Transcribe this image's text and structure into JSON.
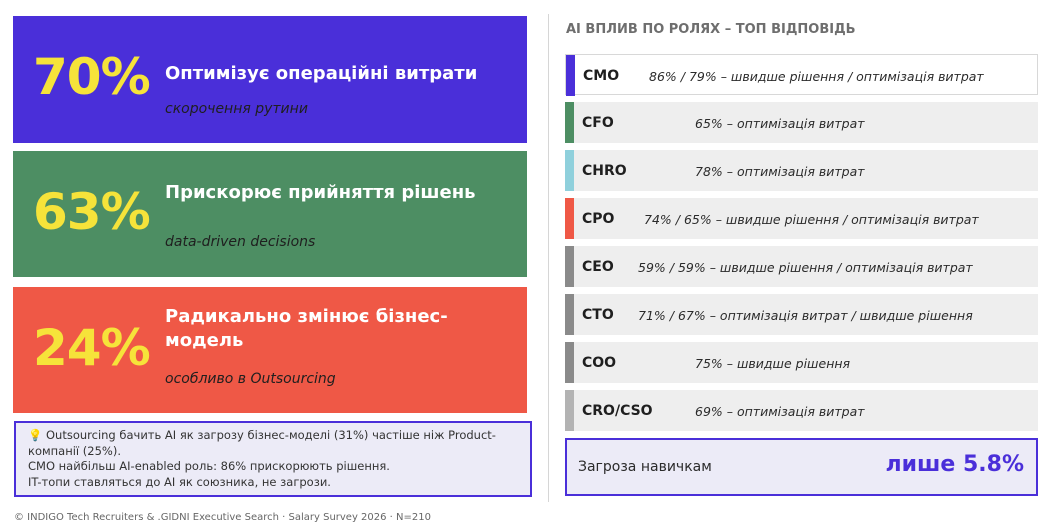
{
  "cards": [
    {
      "pct": "70%",
      "title": "Оптимізує операційні витрати",
      "sub": "скорочення рутини",
      "color": "#4a2fd9"
    },
    {
      "pct": "63%",
      "title": "Прискорює прийняття рішень",
      "sub": "data-driven decisions",
      "color": "#4d8e63"
    },
    {
      "pct": "24%",
      "title": "Радикально змінює бізнес-модель",
      "sub": "особливо в Outsourcing",
      "color": "#ef5846"
    }
  ],
  "note": {
    "icon": "lightbulb-icon",
    "line1": "Outsourcing бачить AI як загрозу бізнес-моделі (31%) частіше ніж Product-компанії (25%).",
    "line2": "CMO  найбільш AI-enabled роль: 86% прискорюють рішення.",
    "line3": "IT-топи ставляться до AI як союзника, не загрози."
  },
  "right_panel": {
    "heading": "AI ВПЛИВ ПО РОЛЯХ – ТОП ВІДПОВІДЬ",
    "roles": [
      {
        "role": "CMO",
        "desc": "86% / 79% – швидше рішення / оптимізація витрат",
        "color": "#4a2fd9"
      },
      {
        "role": "CFO",
        "desc": "65% – оптимізація витрат",
        "color": "#4d8e63"
      },
      {
        "role": "CHRO",
        "desc": "78% – оптимізація витрат",
        "color": "#8fd0dc"
      },
      {
        "role": "CPO",
        "desc": "74% / 65%  – швидше рішення / оптимізація витрат",
        "color": "#ef5846"
      },
      {
        "role": "CEO",
        "desc": "59% / 59%  – швидше рішення / оптимізація витрат",
        "color": "#8a8a8a"
      },
      {
        "role": "CTO",
        "desc": "71% / 67%  – оптимізація витрат / швидше рішення",
        "color": "#8a8a8a"
      },
      {
        "role": "COO",
        "desc": "75% – швидше рішення",
        "color": "#8a8a8a"
      },
      {
        "role": "CRO/CSO",
        "desc": "69% – оптимізація витрат",
        "color": "#b3b3b3"
      }
    ],
    "threat": {
      "label": "Загроза навичкам",
      "value": "лише 5.8%"
    }
  },
  "footer": "© INDIGO Tech Recruiters & .GIDNI Executive Search · Salary Survey 2026 · N=210"
}
